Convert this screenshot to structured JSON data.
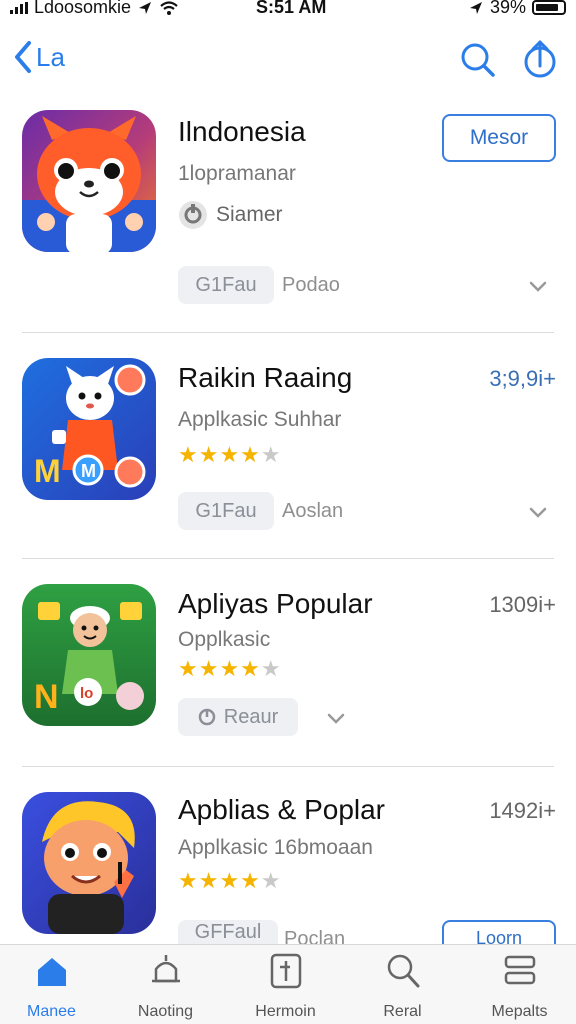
{
  "status_bar": {
    "carrier": "Ldoosomkie",
    "time": "S:51 AM",
    "battery": "39%"
  },
  "nav": {
    "back_label": "La"
  },
  "apps": [
    {
      "title": "Ilndonesia",
      "subtitle": "1lopramanar",
      "developer": "Siamer",
      "get_label": "G1Fau",
      "get_note": "Podao",
      "action_label": "Mesor"
    },
    {
      "title": "Raikin Raaing",
      "subtitle": "Applkasic Suhhar",
      "rating": 4,
      "price": "3;9,9i+",
      "get_label": "G1Fau",
      "get_note": "Aoslan"
    },
    {
      "title": "Apliyas Popular",
      "subtitle": "Opplkasic",
      "rating": 4,
      "price": "1309i+",
      "get_label": "Reaur"
    },
    {
      "title": "Apblias & Poplar",
      "subtitle": "Applkasic 16bmoaan",
      "rating": 4,
      "price": "1492i+",
      "get_label": "GFFaul",
      "get_note": "Poclan",
      "action_label": "Loorn"
    }
  ],
  "tabs": [
    {
      "label": "Manee",
      "active": true
    },
    {
      "label": "Naoting",
      "active": false
    },
    {
      "label": "Hermoin",
      "active": false
    },
    {
      "label": "Reral",
      "active": false
    },
    {
      "label": "Mepalts",
      "active": false
    }
  ],
  "colors": {
    "accent": "#2b7de9",
    "star": "#f5b400",
    "divider": "#dcdcdc"
  }
}
